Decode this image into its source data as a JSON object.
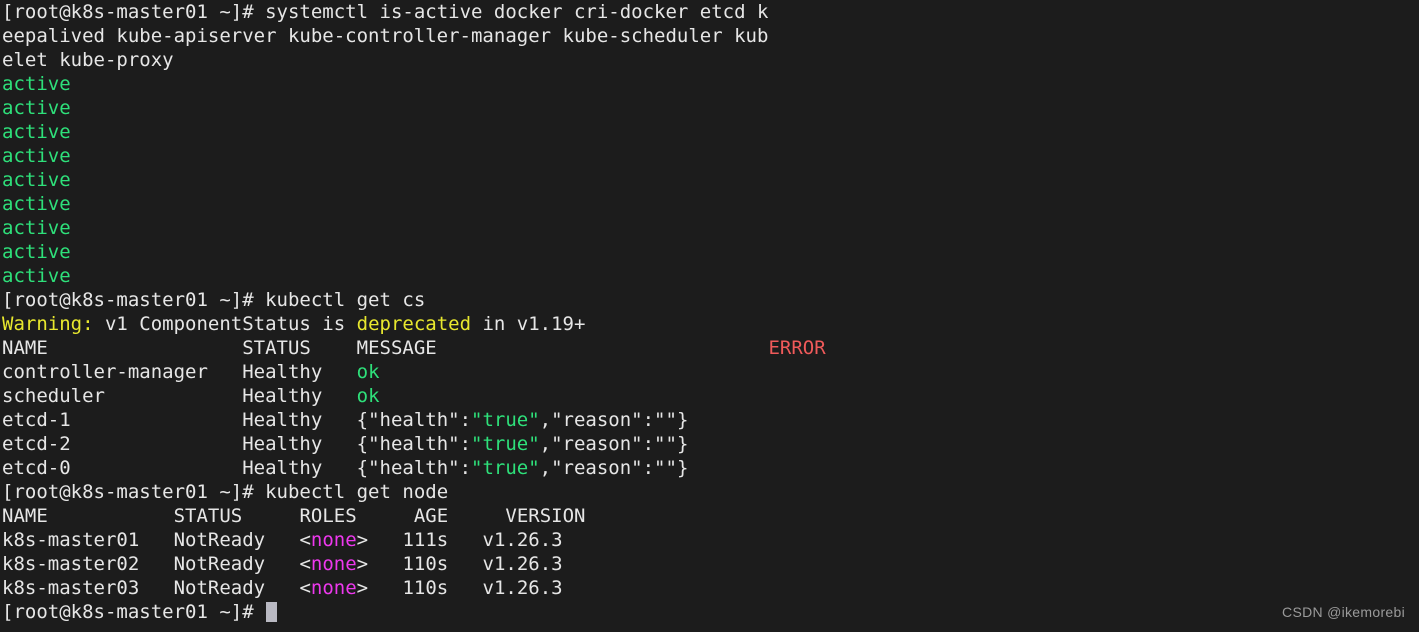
{
  "terminal": {
    "background": "#1c1c1c",
    "foreground": "#e6e6e6",
    "colors": {
      "green": "#2ee07a",
      "yellow": "#e8e82e",
      "red": "#f05a5a",
      "magenta": "#ee38ee",
      "white": "#e6e6e6",
      "cursor": "#b9b9c2"
    },
    "prompt": "[root@k8s-master01 ~]# ",
    "hostname": "k8s-master01",
    "user": "root"
  },
  "command1": {
    "prompt": "[root@k8s-master01 ~]# ",
    "text_part1": "systemctl is-active docker cri-docker etcd k",
    "text_part2": "eepalived kube-apiserver kube-controller-manager kube-scheduler kub",
    "text_part3": "elet kube-proxy",
    "full": "systemctl is-active docker cri-docker etcd keepalived kube-apiserver kube-controller-manager kube-scheduler kubelet kube-proxy"
  },
  "output1": {
    "lines": [
      "active",
      "active",
      "active",
      "active",
      "active",
      "active",
      "active",
      "active",
      "active"
    ]
  },
  "command2": {
    "prompt": "[root@k8s-master01 ~]# ",
    "text": "kubectl get cs"
  },
  "warning": {
    "label": "Warning:",
    "mid": " v1 ComponentStatus is ",
    "keyword": "deprecated",
    "tail": " in v1.19+"
  },
  "cs_table": {
    "headers": {
      "name": "NAME",
      "status": "STATUS",
      "message": "MESSAGE",
      "error": "ERROR"
    },
    "header_line": "NAME                 STATUS    MESSAGE                             ERROR",
    "rows": [
      {
        "name": "controller-manager",
        "status": "Healthy",
        "message_plain": "ok",
        "message_kind": "ok",
        "error": ""
      },
      {
        "name": "scheduler",
        "status": "Healthy",
        "message_plain": "ok",
        "message_kind": "ok",
        "error": ""
      },
      {
        "name": "etcd-1",
        "status": "Healthy",
        "message_plain": "{\"health\":\"true\",\"reason\":\"\"}",
        "message_kind": "json",
        "json_prefix": "{\"health\":",
        "json_value": "\"true\"",
        "json_suffix": ",\"reason\":\"\"}",
        "error": ""
      },
      {
        "name": "etcd-2",
        "status": "Healthy",
        "message_plain": "{\"health\":\"true\",\"reason\":\"\"}",
        "message_kind": "json",
        "json_prefix": "{\"health\":",
        "json_value": "\"true\"",
        "json_suffix": ",\"reason\":\"\"}",
        "error": ""
      },
      {
        "name": "etcd-0",
        "status": "Healthy",
        "message_plain": "{\"health\":\"true\",\"reason\":\"\"}",
        "message_kind": "json",
        "json_prefix": "{\"health\":",
        "json_value": "\"true\"",
        "json_suffix": ",\"reason\":\"\"}",
        "error": ""
      }
    ]
  },
  "command3": {
    "prompt": "[root@k8s-master01 ~]# ",
    "text": "kubectl get node"
  },
  "node_table": {
    "headers": {
      "name": "NAME",
      "status": "STATUS",
      "roles": "ROLES",
      "age": "AGE",
      "version": "VERSION"
    },
    "rows": [
      {
        "name": "k8s-master01",
        "status": "NotReady",
        "roles_open": "<",
        "roles_value": "none",
        "roles_close": ">",
        "age": "111s",
        "version": "v1.26.3"
      },
      {
        "name": "k8s-master02",
        "status": "NotReady",
        "roles_open": "<",
        "roles_value": "none",
        "roles_close": ">",
        "age": "110s",
        "version": "v1.26.3"
      },
      {
        "name": "k8s-master03",
        "status": "NotReady",
        "roles_open": "<",
        "roles_value": "none",
        "roles_close": ">",
        "age": "110s",
        "version": "v1.26.3"
      }
    ]
  },
  "final_prompt": {
    "prompt": "[root@k8s-master01 ~]# "
  },
  "watermark": {
    "text": "CSDN @ikemorebi"
  }
}
